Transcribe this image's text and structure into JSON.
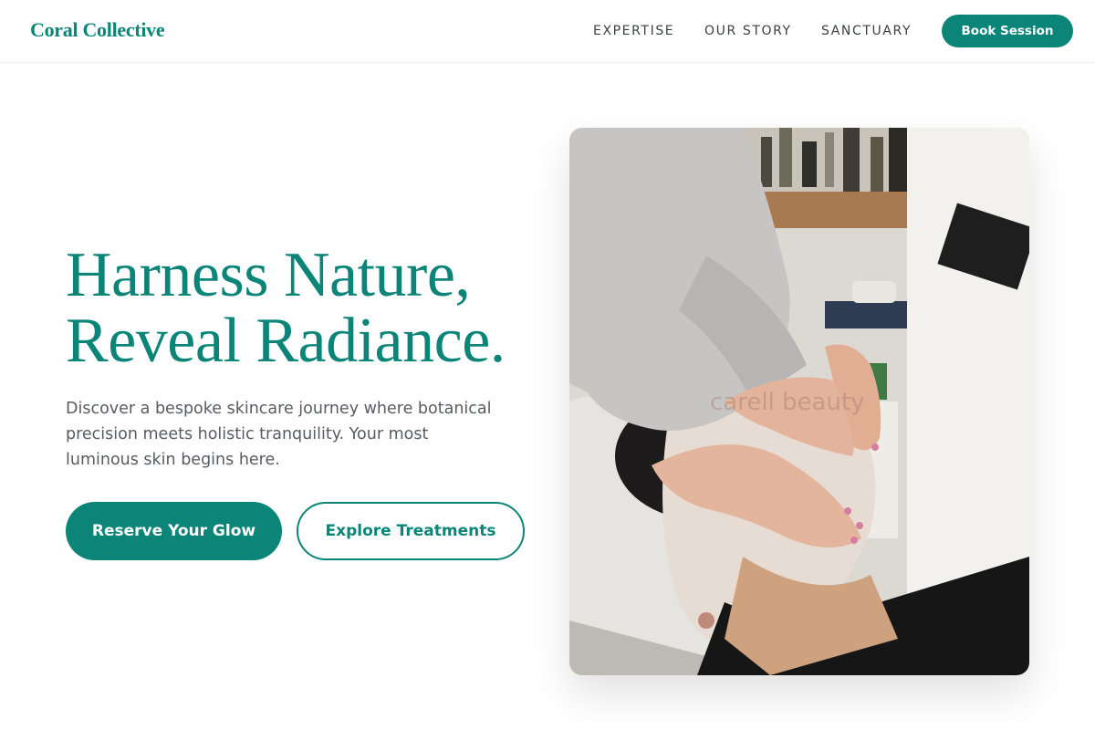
{
  "brand": {
    "name": "Coral Collective",
    "accent_color": "#0b8578"
  },
  "nav": {
    "items": [
      {
        "label": "EXPERTISE"
      },
      {
        "label": "OUR STORY"
      },
      {
        "label": "SANCTUARY"
      }
    ],
    "cta_label": "Book Session"
  },
  "hero": {
    "headline_line1": "Harness Nature,",
    "headline_line2": "Reveal Radiance.",
    "description": "Discover a bespoke skincare journey where botanical precision meets holistic tranquility. Your most luminous skin begins here.",
    "primary_button": "Reserve Your Glow",
    "secondary_button": "Explore Treatments",
    "image": {
      "subject": "Esthetician applying facial cream to a client lying on a treatment bed",
      "watermark": "carell beauty"
    }
  }
}
